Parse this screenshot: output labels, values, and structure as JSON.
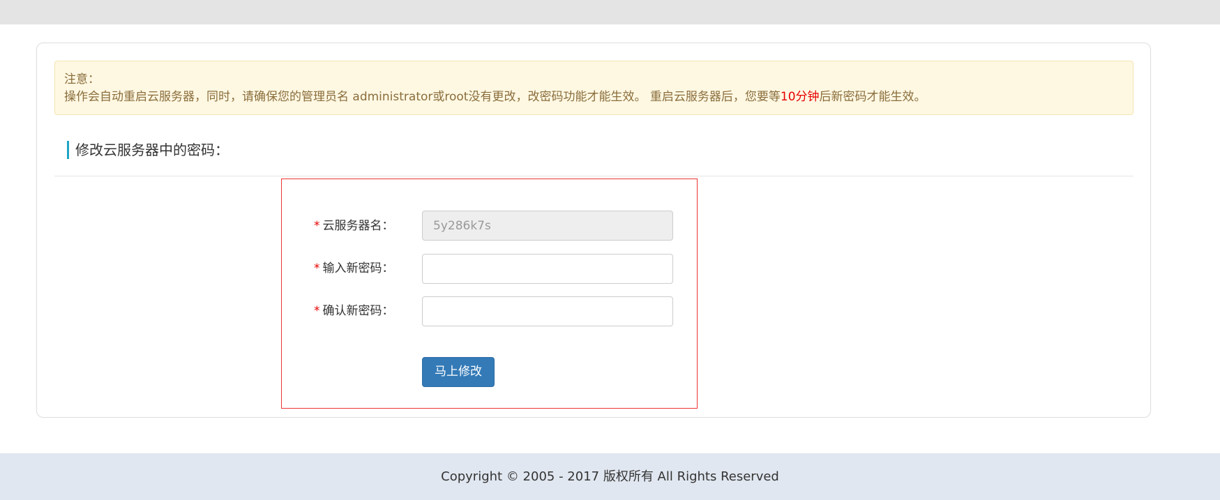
{
  "notice": {
    "title": "注意：",
    "line_before": "操作会自动重启云服务器，同时，请确保您的管理员名 administrator或root没有更改，改密码功能才能生效。 重启云服务器后，您要等",
    "line_highlight": "10分钟",
    "line_after": "后新密码才能生效。"
  },
  "section": {
    "title": "修改云服务器中的密码："
  },
  "form": {
    "required_mark": "*",
    "server_name_label": "云服务器名：",
    "server_name_value": "5y286k7s",
    "new_password_label": "输入新密码：",
    "new_password_value": "",
    "confirm_password_label": "确认新密码：",
    "confirm_password_value": "",
    "submit_label": "马上修改"
  },
  "footer": {
    "copyright": "Copyright © 2005 - 2017 版权所有 All Rights Reserved"
  },
  "colors": {
    "accent": "#337ab7",
    "highlight": "#e60000",
    "notice_bg": "#fef8e3",
    "title_bar": "#1fa4c4"
  }
}
